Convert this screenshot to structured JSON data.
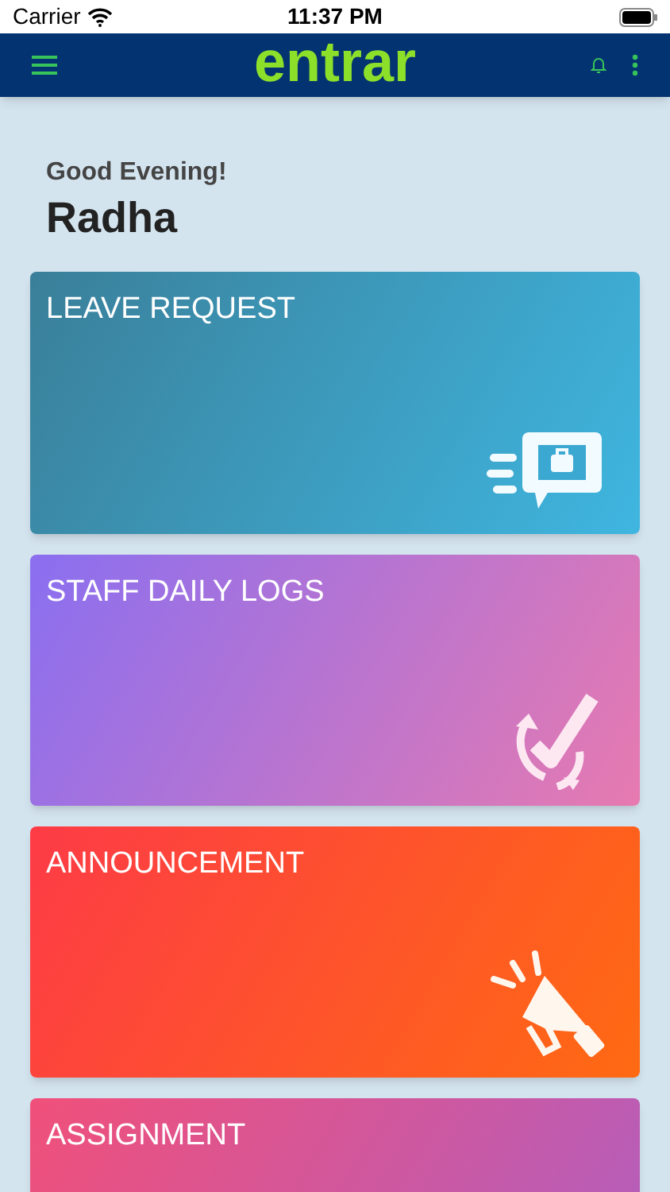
{
  "status_bar": {
    "carrier": "Carrier",
    "time": "11:37 PM"
  },
  "header": {
    "logo": "entrar"
  },
  "greeting": {
    "salutation": "Good Evening!",
    "name": "Radha"
  },
  "cards": [
    {
      "kind": "leave",
      "title": "LEAVE REQUEST"
    },
    {
      "kind": "logs",
      "title": "STAFF DAILY LOGS"
    },
    {
      "kind": "announcement",
      "title": "ANNOUNCEMENT"
    },
    {
      "kind": "assignment",
      "title": "ASSIGNMENT"
    }
  ]
}
